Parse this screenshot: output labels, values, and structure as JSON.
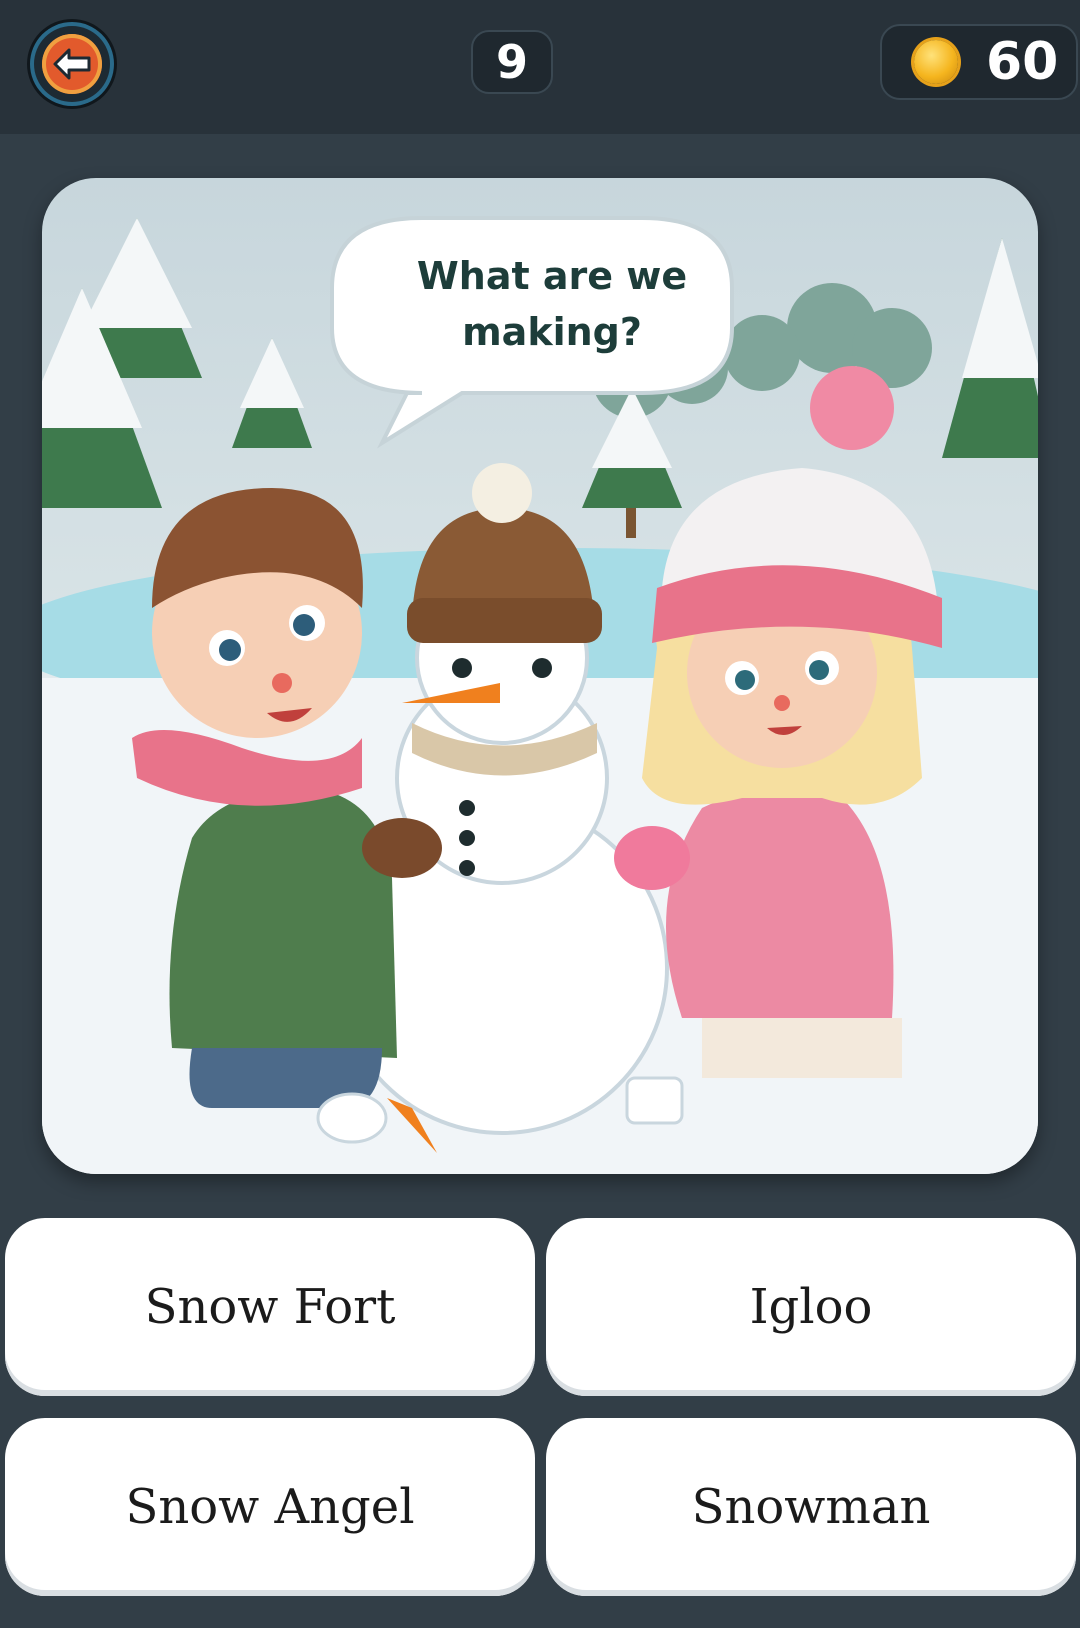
{
  "header": {
    "back_icon": "back-arrow-icon",
    "level": "9",
    "coin_icon": "coin-icon",
    "coins": "60"
  },
  "question": {
    "speech_bubble": "What are we making?"
  },
  "answers": [
    {
      "label": "Snow Fort"
    },
    {
      "label": "Igloo"
    },
    {
      "label": "Snow Angel"
    },
    {
      "label": "Snowman"
    }
  ]
}
